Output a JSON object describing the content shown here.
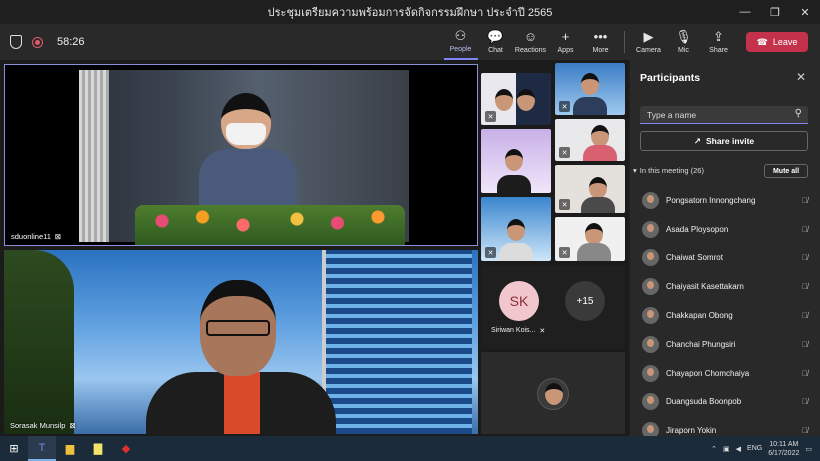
{
  "window": {
    "title": "ประชุมเตรียมความพร้อมการจัดกิจกรรมฝึกษา ประจำปี 2565",
    "minimize": "—",
    "restore": "❐",
    "close": "✕"
  },
  "toolbar": {
    "timer": "58:26",
    "buttons": [
      {
        "label": "People",
        "icon": "⚇"
      },
      {
        "label": "Chat",
        "icon": "💬"
      },
      {
        "label": "Reactions",
        "icon": "☺"
      },
      {
        "label": "Apps",
        "icon": "+"
      },
      {
        "label": "More",
        "icon": "•••"
      }
    ],
    "media": [
      {
        "label": "Camera",
        "icon": "▶"
      },
      {
        "label": "Mic",
        "icon": "🎙"
      },
      {
        "label": "Share",
        "icon": "⇪"
      }
    ],
    "leave_label": "Leave",
    "leave_icon": "☎"
  },
  "stage": {
    "main_tiles": [
      {
        "name": "sduonline11"
      },
      {
        "name": "Sorasak Munsilp"
      }
    ],
    "sk_tile": {
      "initials": "SK",
      "name": "Siriwan Kois...",
      "overflow": "+15"
    }
  },
  "panel": {
    "title": "Participants",
    "close_icon": "✕",
    "search_placeholder": "Type a name",
    "search_icon": "⚲",
    "share_invite_label": "Share invite",
    "share_invite_icon": "↗",
    "in_meeting_label": "In this meeting (26)",
    "mute_all_label": "Mute all",
    "mic_off_icon": "🎙̸",
    "participants": [
      "Pongsatorn Innongchang",
      "Asada Ploysopon",
      "Chaiwat Somrot",
      "Chaiyasit Kasettakarn",
      "Chakkapan Obong",
      "Chanchai Phungsiri",
      "Chayapon Chomchaiya",
      "Duangsuda Boonpob",
      "Jiraporn Yokin"
    ]
  },
  "taskbar": {
    "language": "ENG",
    "time": "10:11 AM",
    "date": "6/17/2022"
  }
}
